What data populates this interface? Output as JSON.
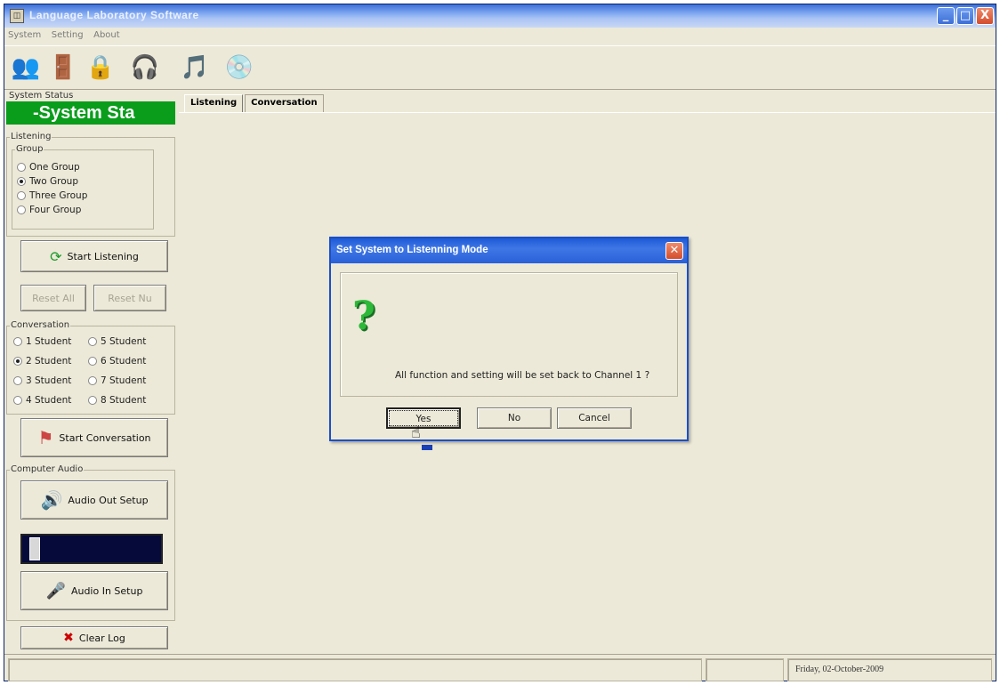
{
  "window": {
    "title": "Language Laboratory Software",
    "controls": {
      "minimize": "_",
      "maximize": "□",
      "close": "X"
    }
  },
  "menu": [
    "System",
    "Setting",
    "About"
  ],
  "toolbar": [
    "user-group-icon",
    "exit-door-icon",
    "padlock-icon",
    "headset-icon",
    "music-note-icon",
    "disc-icon"
  ],
  "left_panel": {
    "system_status_label": "System Status",
    "system_status_text": "-System Sta",
    "listening_label": "Listening",
    "group_label": "Group",
    "groups": [
      {
        "label": "One Group",
        "selected": false
      },
      {
        "label": "Two Group",
        "selected": true
      },
      {
        "label": "Three Group",
        "selected": false
      },
      {
        "label": "Four Group",
        "selected": false
      }
    ],
    "start_listening": "Start Listening",
    "reset_all": "Reset All",
    "reset_nu": "Reset Nu",
    "conversation_label": "Conversation",
    "students": [
      {
        "label": "1 Student",
        "selected": false
      },
      {
        "label": "5 Student",
        "selected": false
      },
      {
        "label": "2 Student",
        "selected": true
      },
      {
        "label": "6 Student",
        "selected": false
      },
      {
        "label": "3 Student",
        "selected": false
      },
      {
        "label": "7 Student",
        "selected": false
      },
      {
        "label": "4 Student",
        "selected": false
      },
      {
        "label": "8 Student",
        "selected": false
      }
    ],
    "start_conversation": "Start Conversation",
    "computer_audio_label": "Computer Audio",
    "audio_out_setup": "Audio Out Setup",
    "audio_in_setup": "Audio In Setup",
    "clear_log": "Clear Log"
  },
  "tabs": [
    "Listening",
    "Conversation"
  ],
  "dialog": {
    "title": "Set System to Listenning Mode",
    "message": "All function and setting will be set back to Channel 1 ?",
    "yes": "Yes",
    "no": "No",
    "cancel": "Cancel"
  },
  "statusbar": {
    "date": "Friday, 02-October-2009"
  }
}
